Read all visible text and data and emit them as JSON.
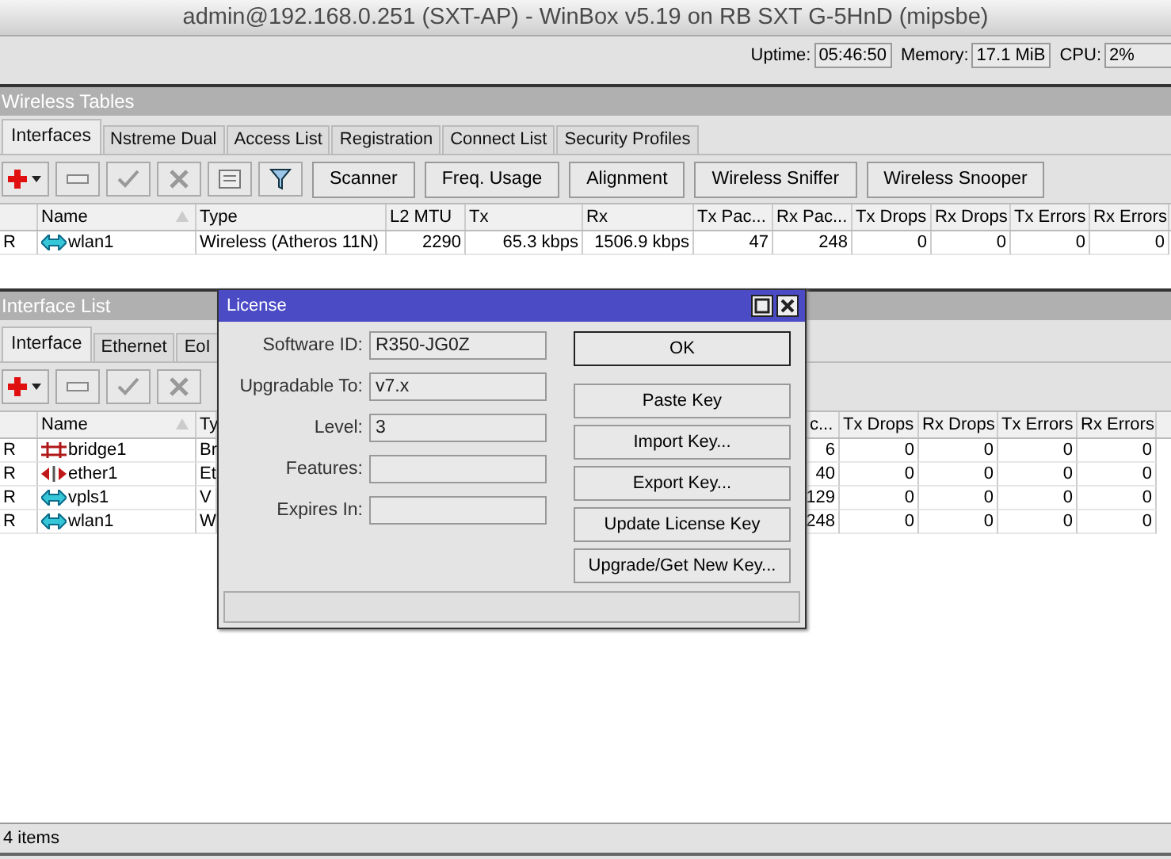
{
  "window": {
    "title": "admin@192.168.0.251 (SXT-AP) - WinBox v5.19 on RB SXT G-5HnD (mipsbe)"
  },
  "status": [
    {
      "label": "Uptime:",
      "value": "05:46:50"
    },
    {
      "label": "Memory:",
      "value": "17.1 MiB"
    },
    {
      "label": "CPU:",
      "value": "2%"
    }
  ],
  "wireless_tables": {
    "title": "Wireless Tables",
    "tabs": [
      {
        "label": "Interfaces",
        "selected": true
      },
      {
        "label": "Nstreme Dual",
        "selected": false
      },
      {
        "label": "Access List",
        "selected": false
      },
      {
        "label": "Registration",
        "selected": false
      },
      {
        "label": "Connect List",
        "selected": false
      },
      {
        "label": "Security Profiles",
        "selected": false
      }
    ],
    "buttons": [
      "Scanner",
      "Freq. Usage",
      "Alignment",
      "Wireless Sniffer",
      "Wireless Snooper"
    ],
    "columns": [
      "Name",
      "Type",
      "L2 MTU",
      "Tx",
      "Rx",
      "Tx Pac...",
      "Rx Pac...",
      "Tx Drops",
      "Rx Drops",
      "Tx Errors",
      "Rx Errors"
    ],
    "rows": [
      {
        "flag": "R",
        "kind": "wireless",
        "cells": [
          "wlan1",
          "Wireless (Atheros 11N)",
          "2290",
          "65.3 kbps",
          "1506.9 kbps",
          "47",
          "248",
          "0",
          "0",
          "0",
          "0"
        ]
      }
    ]
  },
  "interface_list": {
    "title": "Interface List",
    "tabs": [
      {
        "label": "Interface",
        "selected": true
      },
      {
        "label": "Ethernet",
        "selected": false
      },
      {
        "label": "EoI",
        "selected": false
      }
    ],
    "columns": [
      "Name",
      "Ty",
      "c...",
      "Tx Drops",
      "Rx Drops",
      "Tx Errors",
      "Rx Errors"
    ],
    "rows": [
      {
        "flag": "R",
        "kind": "bridge",
        "cells": [
          "bridge1",
          "Br",
          "6",
          "0",
          "0",
          "0",
          "0"
        ]
      },
      {
        "flag": "R",
        "kind": "ethernet",
        "cells": [
          "ether1",
          "Et",
          "40",
          "0",
          "0",
          "0",
          "0"
        ]
      },
      {
        "flag": "R",
        "kind": "wireless",
        "cells": [
          "vpls1",
          "V",
          "129",
          "0",
          "0",
          "0",
          "0"
        ]
      },
      {
        "flag": "R",
        "kind": "wireless",
        "cells": [
          "wlan1",
          "W",
          "248",
          "0",
          "0",
          "0",
          "0"
        ]
      }
    ],
    "status": "4 items"
  },
  "license": {
    "title": "License",
    "fields": [
      {
        "label": "Software ID:",
        "value": "R350-JG0Z"
      },
      {
        "label": "Upgradable To:",
        "value": "v7.x"
      },
      {
        "label": "Level:",
        "value": "3"
      },
      {
        "label": "Features:"
      },
      {
        "label": "Expires In:"
      }
    ],
    "buttons": [
      "OK",
      "Paste Key",
      "Import Key...",
      "Export Key...",
      "Update License Key",
      "Upgrade/Get New Key..."
    ]
  }
}
